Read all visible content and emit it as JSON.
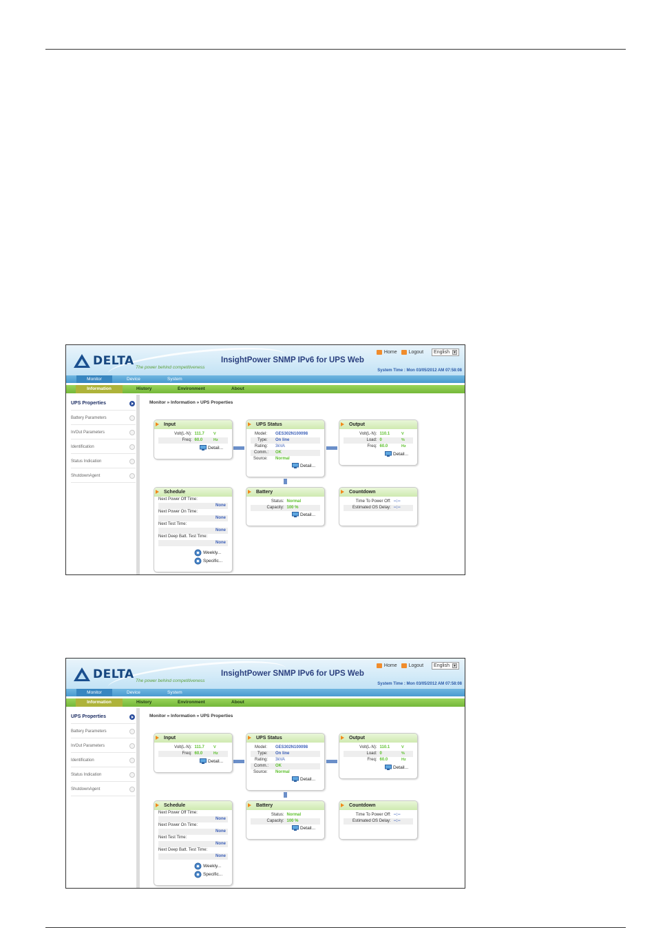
{
  "app": {
    "brand": "DELTA",
    "tagline": "The power behind competitiveness",
    "title": "InsightPower SNMP IPv6 for UPS Web",
    "home_label": "Home",
    "logout_label": "Logout",
    "language": "English",
    "system_time": "System Time : Mon 03/05/2012 AM 07:58:08"
  },
  "menu_primary": [
    "Monitor",
    "Device",
    "System"
  ],
  "menu_secondary": [
    "Information",
    "History",
    "Environment",
    "About"
  ],
  "sidebar": [
    "UPS Properties",
    "Battery Parameters",
    "In/Out Parameters",
    "Identification",
    "Status Indication",
    "ShutdownAgent"
  ],
  "breadcrumb": "Monitor » Information » UPS Properties",
  "input": {
    "title": "Input",
    "volt_label": "Volt(L-N):",
    "volt_value": "111.7",
    "volt_unit": "V",
    "freq_label": "Freq:",
    "freq_value": "60.0",
    "freq_unit": "Hz",
    "detail": "Detail..."
  },
  "ups_status": {
    "title": "UPS Status",
    "model_label": "Model:",
    "model_value": "GES302N100098",
    "type_label": "Type:",
    "type_value": "On line",
    "rating_label": "Rating:",
    "rating_value": "3kVA",
    "comm_label": "Comm.:",
    "comm_value": "OK",
    "source_label": "Source:",
    "source_value": "Normal",
    "detail": "Detail..."
  },
  "output": {
    "title": "Output",
    "volt_label": "Volt(L-N):",
    "volt_value": "110.1",
    "volt_unit": "V",
    "load_label": "Load:",
    "load_value": "0",
    "load_unit": "%",
    "freq_label": "Freq:",
    "freq_value": "60.0",
    "freq_unit": "Hz",
    "detail": "Detail..."
  },
  "schedule": {
    "title": "Schedule",
    "poweroff_label": "Next Power Off Time:",
    "poweroff_value": "None",
    "poweron_label": "Next Power On Time:",
    "poweron_value": "None",
    "test_label": "Next Test Time:",
    "test_value": "None",
    "deeptest_label": "Next Deep Batt. Test Time:",
    "deeptest_value": "None",
    "weekly": "Weekly...",
    "specific": "Specific..."
  },
  "battery": {
    "title": "Battery",
    "status_label": "Status:",
    "status_value": "Normal",
    "capacity_label": "Capacity:",
    "capacity_value": "100 %",
    "detail": "Detail..."
  },
  "countdown": {
    "title": "Countdown",
    "poweroff_label": "Time To Power Off:",
    "poweroff_value": "--:--",
    "osdelay_label": "Estimated OS Delay:",
    "osdelay_value": "--:--"
  },
  "colors": {
    "value_green": "#5bbf2a",
    "value_blue": "#3b5fb8",
    "menu_blue": "#4a9ad0",
    "menu_green": "#74b83a"
  }
}
